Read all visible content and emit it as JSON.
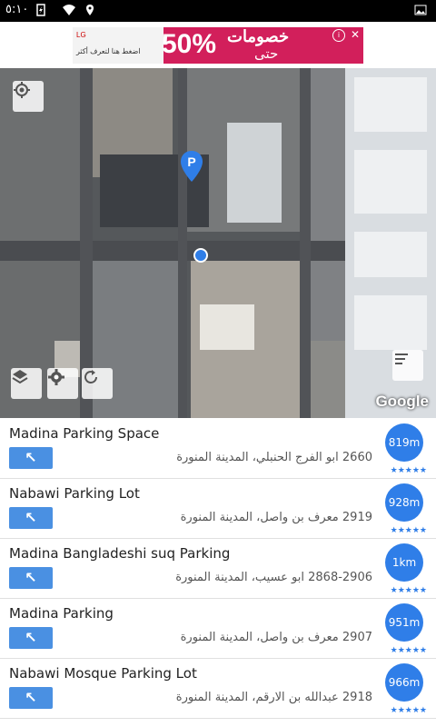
{
  "status": {
    "time": "٥:١٠"
  },
  "ad": {
    "brand": "LG",
    "cta": "اضغط هنا لتعرف أكثر",
    "percent": "50%",
    "headline": "خصومات",
    "subline": "حتى",
    "info": "i",
    "close": "✕"
  },
  "map": {
    "attribution": "Google",
    "buttons": [
      "my-location",
      "layers",
      "settings",
      "refresh",
      "list"
    ]
  },
  "places": [
    {
      "name": "Madina Parking Space",
      "address": "2660 ابو الفرج الحنبلي، المدينة المنورة",
      "distance": "819m",
      "rating": "★★★★★",
      "nav": "↖"
    },
    {
      "name": "Nabawi Parking Lot",
      "address": "2919 معرف بن واصل، المدينة المنورة",
      "distance": "928m",
      "rating": "★★★★★",
      "nav": "↖"
    },
    {
      "name": "Madina Bangladeshi suq Parking",
      "address": "2868-2906 ابو عسيب، المدينة المنورة",
      "distance": "1km",
      "rating": "★★★★★",
      "nav": "↖"
    },
    {
      "name": "Madina Parking",
      "address": "2907 معرف بن واصل، المدينة المنورة",
      "distance": "951m",
      "rating": "★★★★★",
      "nav": "↖"
    },
    {
      "name": "Nabawi Mosque Parking Lot",
      "address": "2918 عبدالله بن الارقم، المدينة المنورة",
      "distance": "966m",
      "rating": "★★★★★",
      "nav": "↖"
    }
  ],
  "colors": {
    "accent": "#2f7ee8",
    "nav_button": "#4a90e2",
    "ad_bg": "#d21f5b"
  }
}
